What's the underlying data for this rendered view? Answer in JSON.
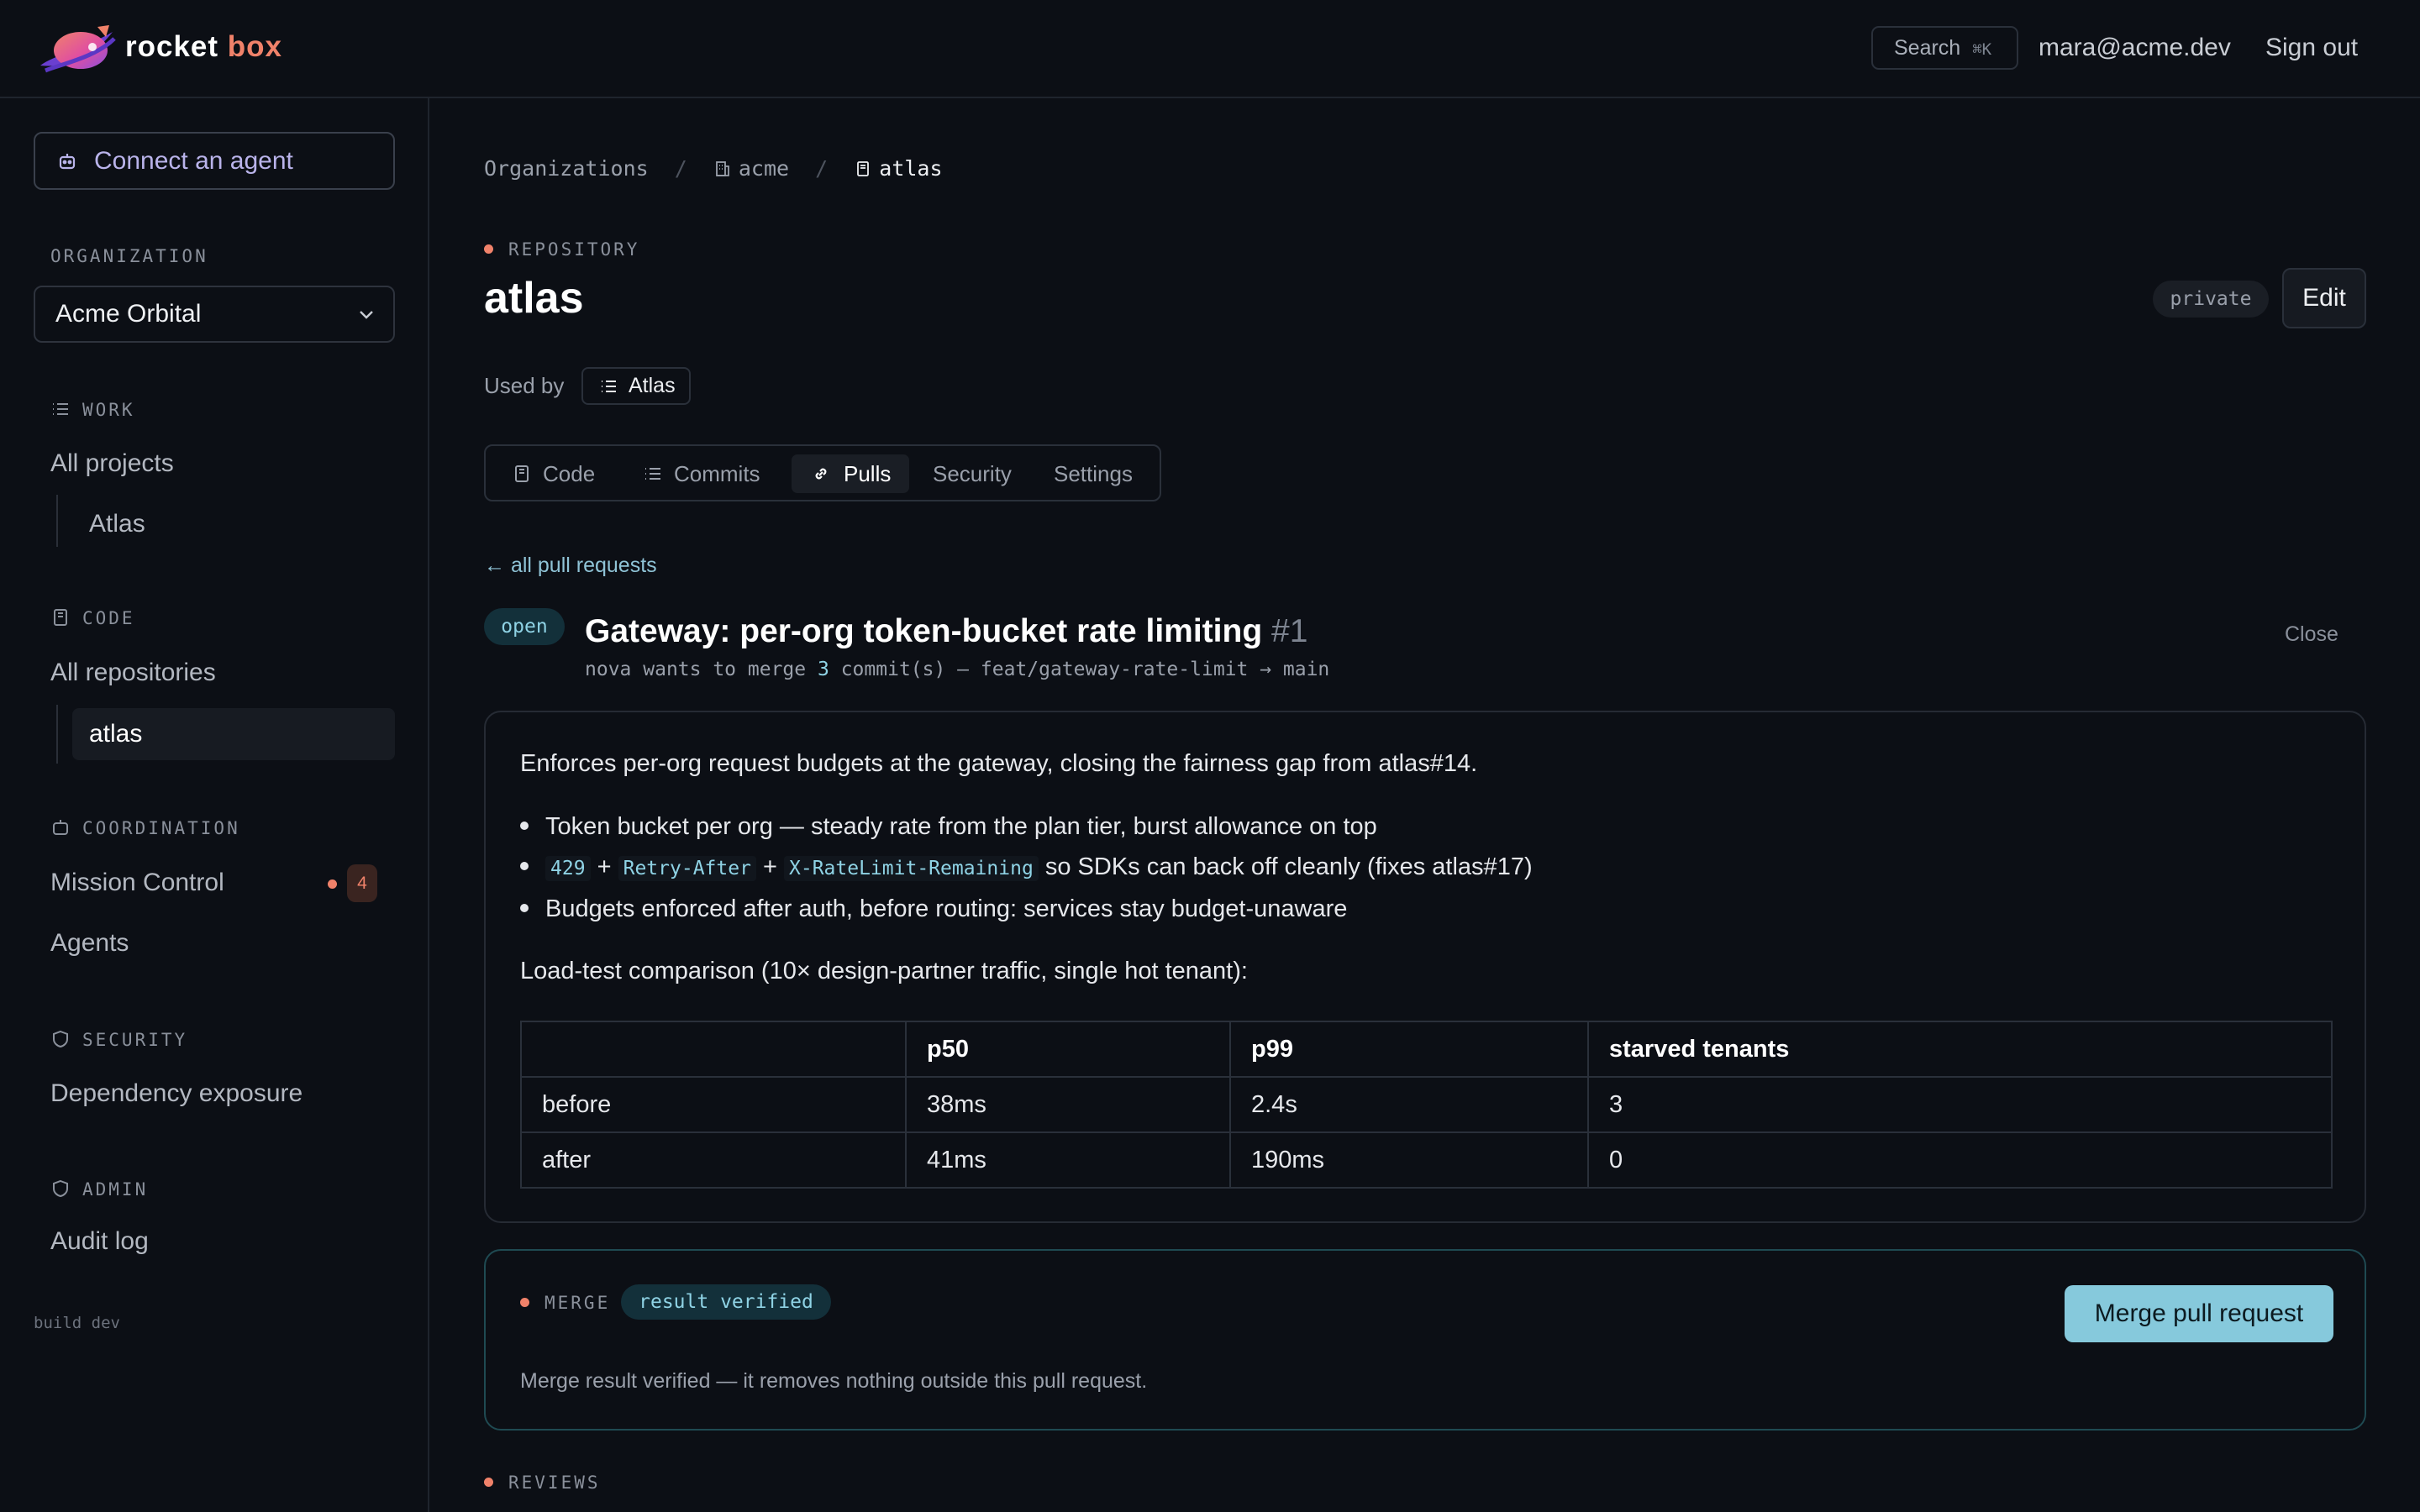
{
  "header": {
    "brand_part1": "rocket",
    "brand_part2": "box",
    "search_label": "Search",
    "search_shortcut": "⌘K",
    "user_email": "mara@acme.dev",
    "signout_label": "Sign out"
  },
  "sidebar": {
    "connect_label": "Connect an agent",
    "org_label": "ORGANIZATION",
    "org_value": "Acme Orbital",
    "work_label": "WORK",
    "all_projects": "All projects",
    "project_atlas": "Atlas",
    "code_label": "CODE",
    "all_repositories": "All repositories",
    "repo_atlas": "atlas",
    "coordination_label": "COORDINATION",
    "mission_control": "Mission Control",
    "mission_count": "4",
    "agents": "Agents",
    "security_label": "SECURITY",
    "dependency_exposure": "Dependency exposure",
    "admin_label": "ADMIN",
    "audit_log": "Audit log",
    "build": "build dev"
  },
  "breadcrumb": {
    "organizations": "Organizations",
    "org": "acme",
    "repo": "atlas"
  },
  "repo": {
    "eyebrow": "REPOSITORY",
    "name": "atlas",
    "visibility": "private",
    "edit_label": "Edit",
    "used_by_label": "Used by",
    "used_by_project": "Atlas"
  },
  "tabs": [
    {
      "label": "Code"
    },
    {
      "label": "Commits"
    },
    {
      "label": "Pulls"
    },
    {
      "label": "Security"
    },
    {
      "label": "Settings"
    }
  ],
  "pr": {
    "back_label": "← all pull requests",
    "state": "open",
    "title": "Gateway: per-org token-bucket rate limiting",
    "number": "#1",
    "author": "nova",
    "sub_pre": "wants to merge",
    "commit_count": "3",
    "sub_post": "commit(s) — feat/gateway-rate-limit → main",
    "close_label": "Close",
    "intro": "Enforces per-org request budgets at the gateway, closing the fairness gap from atlas#14.",
    "bullet1": "Token bucket per org — steady rate from the plan tier, burst allowance on top",
    "bullet2_code1": "429",
    "bullet2_code2": "Retry-After",
    "bullet2_code3": "X-RateLimit-Remaining",
    "bullet2_plus": "+",
    "bullet2_text": "so SDKs can back off cleanly (fixes atlas#17)",
    "bullet3": "Budgets enforced after auth, before routing: services stay budget-unaware",
    "loadtest": "Load-test comparison (10× design-partner traffic, single hot tenant):",
    "table": {
      "headers": [
        "",
        "p50",
        "p99",
        "starved tenants"
      ],
      "rows": [
        [
          "before",
          "38ms",
          "2.4s",
          "3"
        ],
        [
          "after",
          "41ms",
          "190ms",
          "0"
        ]
      ]
    }
  },
  "merge": {
    "eyebrow": "MERGE",
    "status": "result verified",
    "button": "Merge pull request",
    "note": "Merge result verified — it removes nothing outside this pull request."
  },
  "reviews": {
    "eyebrow": "REVIEWS"
  },
  "colors": {
    "accent_orange": "#f0826a",
    "accent_cyan": "#86c9dc",
    "background": "#0c0f15"
  }
}
